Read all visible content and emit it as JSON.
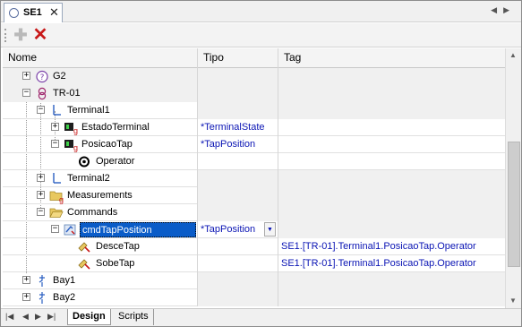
{
  "doc_tab": {
    "label": "SE1",
    "close": "✕"
  },
  "tab_nav": {
    "prev": "◀",
    "next": "▶"
  },
  "toolbar": {
    "add_glyph": "✚",
    "delete_glyph": "✕"
  },
  "columns": {
    "nome": "Nome",
    "tipo": "Tipo",
    "tag": "Tag"
  },
  "rows": [
    {
      "name": "G2",
      "tipo": "",
      "tag": ""
    },
    {
      "name": "TR-01",
      "tipo": "",
      "tag": ""
    },
    {
      "name": "Terminal1",
      "tipo": "",
      "tag": ""
    },
    {
      "name": "EstadoTerminal",
      "tipo": "*TerminalState",
      "tag": ""
    },
    {
      "name": "PosicaoTap",
      "tipo": "*TapPosition",
      "tag": ""
    },
    {
      "name": "Operator",
      "tipo": "",
      "tag": ""
    },
    {
      "name": "Terminal2",
      "tipo": "",
      "tag": ""
    },
    {
      "name": "Measurements",
      "tipo": "",
      "tag": ""
    },
    {
      "name": "Commands",
      "tipo": "",
      "tag": ""
    },
    {
      "name": "cmdTapPosition",
      "tipo": "*TapPosition",
      "tag": ""
    },
    {
      "name": "DesceTap",
      "tipo": "",
      "tag": "SE1.[TR-01].Terminal1.PosicaoTap.Operator"
    },
    {
      "name": "SobeTap",
      "tipo": "",
      "tag": "SE1.[TR-01].Terminal1.PosicaoTap.Operator"
    },
    {
      "name": "Bay1",
      "tipo": "",
      "tag": ""
    },
    {
      "name": "Bay2",
      "tipo": "",
      "tag": ""
    }
  ],
  "expanders": {
    "plus": "+",
    "minus": "−"
  },
  "badge": "g",
  "dropdown_glyph": "▼",
  "scroll": {
    "up": "▲",
    "down": "▼"
  },
  "bottom_nav": {
    "first": "|◀",
    "prev": "◀",
    "next": "▶",
    "last": "▶|"
  },
  "bottom_tabs": {
    "design": "Design",
    "scripts": "Scripts"
  },
  "colors": {
    "selection": "#0a5cc8",
    "tag_text": "#0a14b4",
    "delete": "#c81818"
  }
}
